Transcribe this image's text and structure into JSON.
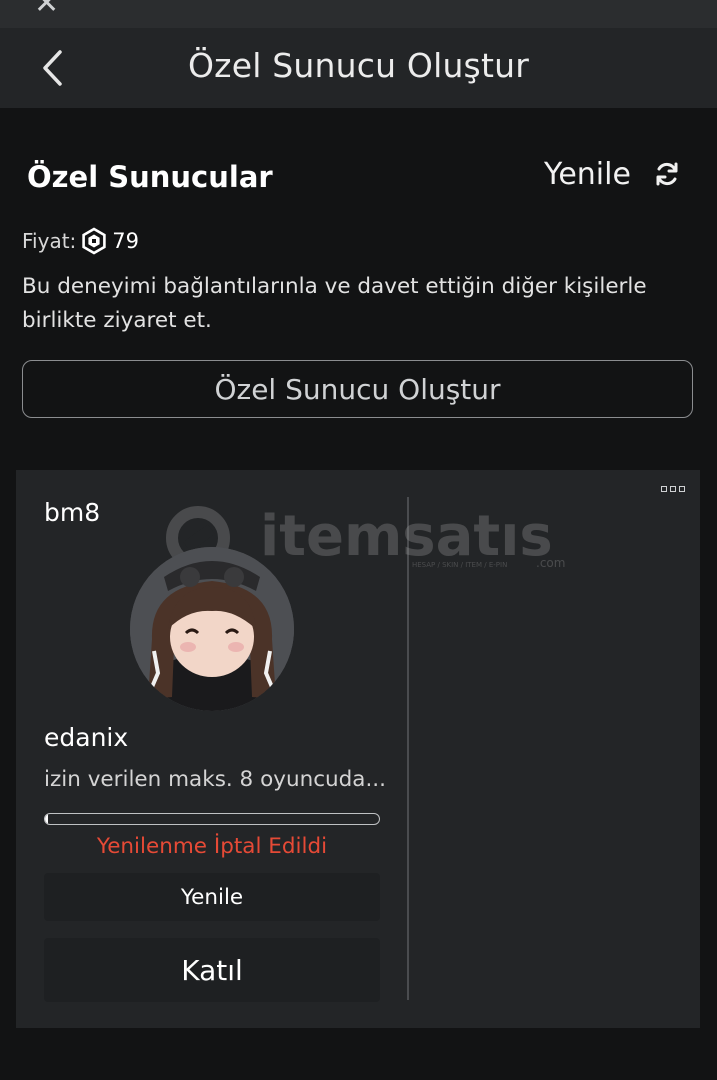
{
  "header": {
    "title": "Özel Sunucu Oluştur"
  },
  "section": {
    "title": "Özel Sunucular",
    "refresh_label": "Yenile",
    "price_label": "Fiyat:",
    "price_amount": "79",
    "description": "Bu deneyimi bağlantılarınla ve davet ettiğin diğer kişilerle birlikte ziyaret et.",
    "create_button": "Özel Sunucu Oluştur"
  },
  "server": {
    "name": "bm8",
    "owner": "edanix",
    "players_text": "izin verilen maks. 8 oyuncuda...",
    "progress": 0.01,
    "status": "Yenilenme İptal Edildi",
    "renew_button": "Yenile",
    "join_button": "Katıl"
  },
  "watermark": {
    "text": "itemsatıs",
    "sub": "HESAP / SKIN / ITEM / E-PIN",
    "suffix": ".com"
  },
  "colors": {
    "accent_red": "#e64a36",
    "card": "#232527",
    "background": "#121314"
  },
  "icons": [
    "close-icon",
    "back-chevron-icon",
    "refresh-icon",
    "robux-icon",
    "more-options-icon"
  ]
}
